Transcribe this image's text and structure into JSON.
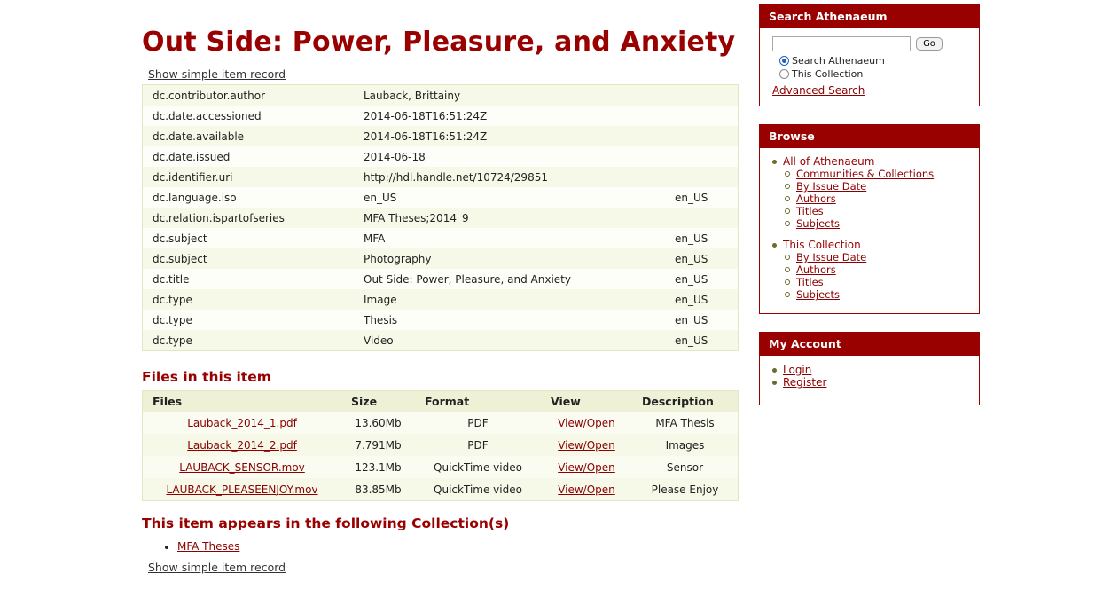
{
  "page_title": "Out Side: Power, Pleasure, and Anxiety",
  "toggle_link": "Show simple item record",
  "metadata": [
    {
      "field": "dc.contributor.author",
      "value": "Lauback, Brittainy",
      "lang": ""
    },
    {
      "field": "dc.date.accessioned",
      "value": "2014-06-18T16:51:24Z",
      "lang": ""
    },
    {
      "field": "dc.date.available",
      "value": "2014-06-18T16:51:24Z",
      "lang": ""
    },
    {
      "field": "dc.date.issued",
      "value": "2014-06-18",
      "lang": ""
    },
    {
      "field": "dc.identifier.uri",
      "value": "http://hdl.handle.net/10724/29851",
      "lang": ""
    },
    {
      "field": "dc.language.iso",
      "value": "en_US",
      "lang": "en_US"
    },
    {
      "field": "dc.relation.ispartofseries",
      "value": "MFA Theses;2014_9",
      "lang": ""
    },
    {
      "field": "dc.subject",
      "value": "MFA",
      "lang": "en_US"
    },
    {
      "field": "dc.subject",
      "value": "Photography",
      "lang": "en_US"
    },
    {
      "field": "dc.title",
      "value": "Out Side: Power, Pleasure, and Anxiety",
      "lang": "en_US"
    },
    {
      "field": "dc.type",
      "value": "Image",
      "lang": "en_US"
    },
    {
      "field": "dc.type",
      "value": "Thesis",
      "lang": "en_US"
    },
    {
      "field": "dc.type",
      "value": "Video",
      "lang": "en_US"
    }
  ],
  "files_section": {
    "heading": "Files in this item",
    "headers": {
      "files": "Files",
      "size": "Size",
      "format": "Format",
      "view": "View",
      "description": "Description"
    },
    "rows": [
      {
        "name": "Lauback_2014_1.pdf",
        "size": "13.60Mb",
        "format": "PDF",
        "view": "View/Open",
        "description": "MFA Thesis"
      },
      {
        "name": "Lauback_2014_2.pdf",
        "size": "7.791Mb",
        "format": "PDF",
        "view": "View/Open",
        "description": "Images"
      },
      {
        "name": "LAUBACK_SENSOR.mov",
        "size": "123.1Mb",
        "format": "QuickTime video",
        "view": "View/Open",
        "description": "Sensor"
      },
      {
        "name": "LAUBACK_PLEASEENJOY.mov",
        "size": "83.85Mb",
        "format": "QuickTime video",
        "view": "View/Open",
        "description": "Please Enjoy"
      }
    ]
  },
  "collections_section": {
    "heading": "This item appears in the following Collection(s)",
    "items": [
      "MFA Theses"
    ]
  },
  "sidebar": {
    "search": {
      "title": "Search Athenaeum",
      "input_value": "",
      "go_label": "Go",
      "options": [
        "Search Athenaeum",
        "This Collection"
      ],
      "selected": "Search Athenaeum",
      "advanced_label": "Advanced Search"
    },
    "browse": {
      "title": "Browse",
      "groups": [
        {
          "label": "All of Athenaeum",
          "items": [
            "Communities & Collections",
            "By Issue Date",
            "Authors",
            "Titles",
            "Subjects"
          ]
        },
        {
          "label": "This Collection",
          "items": [
            "By Issue Date",
            "Authors",
            "Titles",
            "Subjects"
          ]
        }
      ]
    },
    "account": {
      "title": "My Account",
      "items": [
        "Login",
        "Register"
      ]
    }
  },
  "colors": {
    "brand": "#990000",
    "table_tint": "#f6f8e8"
  }
}
